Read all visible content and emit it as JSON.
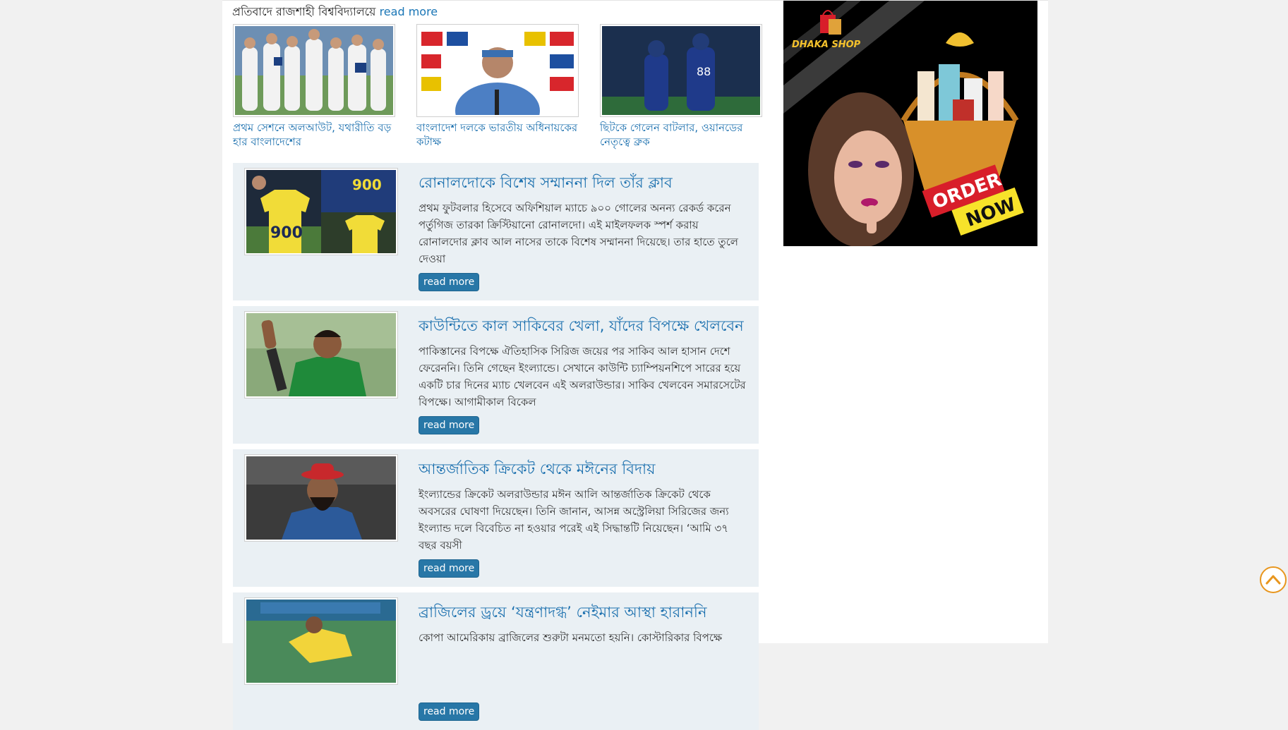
{
  "top_line": {
    "text": "প্রতিবাদে রাজশাহী বিশ্ববিদ্যালয়ে",
    "link": "read more"
  },
  "thumbs": [
    {
      "title": "প্রথম সেশনে অলআউট, যথারীতি বড় হার বাংলাদেশের"
    },
    {
      "title": "বাংলাদেশ দলকে ভারতীয় অধিনায়কের কটাক্ষ"
    },
    {
      "title": "ছিটকে গেলেন বাটলার, ওয়ানডের নেতৃত্বে ব্রুক"
    }
  ],
  "news": [
    {
      "title": "রোনালদোকে বিশেষ সম্মাননা দিল তাঁর ক্লাব",
      "summary": "প্রথম ফুটবলার হিসেবে অফিশিয়াল ম্যাচে ৯০০ গোলের অনন্য রেকর্ড করেন পর্তুগিজ তারকা ক্রিস্টিয়ানো রোনালদো। এই মাইলফলক স্পর্শ করায় রোনালদোর ক্লাব আল নাসের তাকে বিশেষ সম্মাননা দিয়েছে। তার হাতে তুলে দেওয়া",
      "button": "read more"
    },
    {
      "title": "কাউন্টিতে কাল সাকিবের খেলা, যাঁদের বিপক্ষে খেলবেন",
      "summary": "পাকিস্তানের বিপক্ষে ঐতিহাসিক সিরিজ জয়ের পর সাকিব আল হাসান দেশে ফেরেননি। তিনি গেছেন ইংল্যান্ডে। সেখানে কাউন্টি চ্যাম্পিয়নশিপে সারের হয়ে একটি চার দিনের ম্যাচ খেলবেন এই অলরাউন্ডার। সাকিব খেলবেন সমারসেটের বিপক্ষে। আগামীকাল বিকেল",
      "button": "read more"
    },
    {
      "title": "আন্তর্জাতিক ক্রিকেট থেকে মঈনের বিদায়",
      "summary": "ইংল্যান্ডের ক্রিকেট অলরাউন্ডার মঈন আলি আন্তর্জাতিক ক্রিকেট থেকে অবসরের ঘোষণা দিয়েছেন। তিনি জানান, আসন্ন অস্ট্রেলিয়া সিরিজের জন্য ইংল্যান্ড দলে বিবেচিত না হওয়ার পরেই এই সিদ্ধান্তটি নিয়েছেন। ‘আমি ৩৭ বছর বয়সী",
      "button": "read more"
    },
    {
      "title": "ব্রাজিলের ড্রয়ে ‘যন্ত্রণাদগ্ধ’ নেইমার আস্থা হারাননি",
      "summary": "কোপা আমেরিকায় ব্রাজিলের শুরুটা মনমতো হয়নি। কোস্টারিকার বিপক্ষে",
      "button": "read more"
    }
  ],
  "ad": {
    "brand": "DHAKA SHOP",
    "cta_line1": "ORDER",
    "cta_line2": "NOW"
  },
  "colors": {
    "link": "#1a6fae",
    "button": "#2877a7",
    "block_bg": "#eaf0f4",
    "scroll_ring": "#e8961e"
  },
  "icons": {
    "scroll_top": "chevron-up-circle-icon"
  }
}
